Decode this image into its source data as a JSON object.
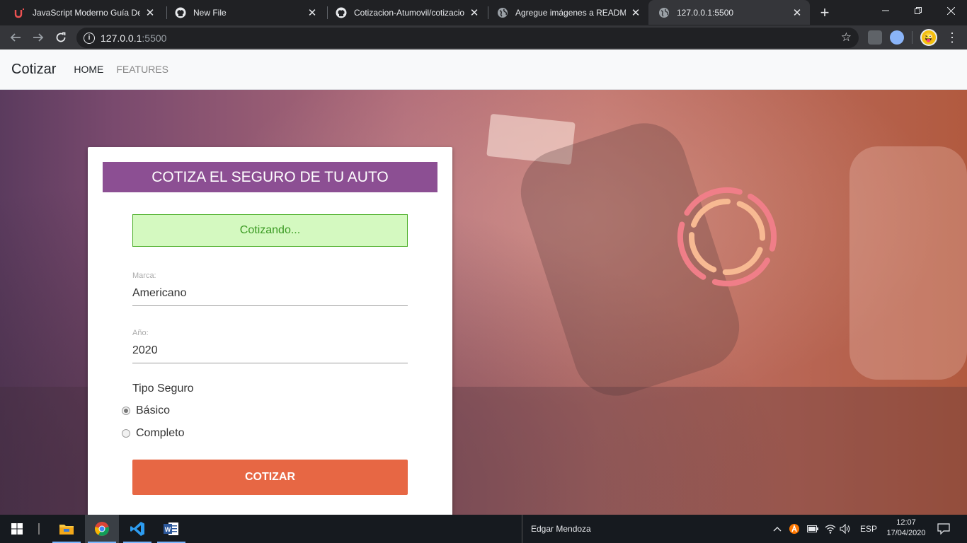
{
  "browser": {
    "tabs": [
      {
        "title": "JavaScript Moderno Guía Definitiva",
        "icon": "udemy-icon",
        "active": false
      },
      {
        "title": "New File",
        "icon": "github-icon",
        "active": false
      },
      {
        "title": "Cotizacion-Atumovil/cotizacion",
        "icon": "github-icon",
        "active": false
      },
      {
        "title": "Agregue imágenes a README.md",
        "icon": "globe-icon",
        "active": false
      },
      {
        "title": "127.0.0.1:5500",
        "icon": "globe-icon",
        "active": true
      }
    ],
    "address": {
      "host": "127.0.0.1",
      "port": ":5500"
    }
  },
  "site": {
    "brand": "Cotizar",
    "nav": [
      "HOME",
      "FEATURES"
    ]
  },
  "form": {
    "title": "COTIZA EL SEGURO DE TU AUTO",
    "status_message": "Cotizando...",
    "marca": {
      "label": "Marca:",
      "value": "Americano"
    },
    "anio": {
      "label": "Año:",
      "value": "2020"
    },
    "tipo_seguro": {
      "label": "Tipo Seguro",
      "options": [
        {
          "label": "Básico",
          "checked": true
        },
        {
          "label": "Completo",
          "checked": false
        }
      ]
    },
    "submit_label": "COTIZAR"
  },
  "colors": {
    "header": "#8c4f93",
    "alert_bg": "#d4f9c0",
    "alert_border": "#4caf28",
    "button": "#e76744",
    "spinner_outer": "#f07e88",
    "spinner_inner": "#f7b992"
  },
  "taskbar": {
    "user_name": "Edgar Mendoza",
    "language": "ESP",
    "time": "12:07",
    "date": "17/04/2020"
  }
}
